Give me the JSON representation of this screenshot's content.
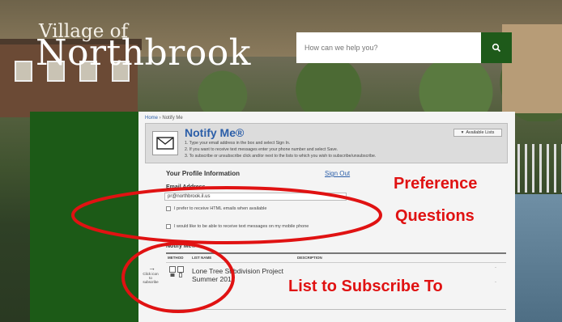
{
  "logo": {
    "line1": "Village of",
    "line2": "Northbrook"
  },
  "search": {
    "placeholder": "How can we help you?",
    "icon": "search-icon"
  },
  "breadcrumb": {
    "home": "Home",
    "separator": " › ",
    "current": "Notify Me"
  },
  "notify": {
    "title": "Notify Me®",
    "instructions": [
      "1. Type your email address in the box and select Sign In.",
      "2. If you want to receive text messages enter your phone number and select Save.",
      "3. To subscribe or unsubscribe click and/or next to the lists to which you wish to subscribe/unsubscribe."
    ],
    "available_lists_button": "Available Lists"
  },
  "profile": {
    "title": "Your Profile Information",
    "sign_out": "Sign Out",
    "email_label": "Email Address",
    "email_value": "pr@northbrook.il.us",
    "html_option": "I prefer to receive HTML emails when available",
    "sms_option": "I would like to be able to receive text messages on my mobile phone"
  },
  "lists": {
    "title": "Notify Me®",
    "columns": [
      "METHOD",
      "LIST NAME",
      "DESCRIPTION"
    ],
    "rows": [
      {
        "name": "Lone Tree Subdivision Project Summer 2017"
      }
    ],
    "click_note": "Click icon to subscribe"
  },
  "annotations": {
    "preference_line1": "Preference",
    "preference_line2": "Questions",
    "list_label": "List to Subscribe To",
    "color": "#e01212"
  }
}
